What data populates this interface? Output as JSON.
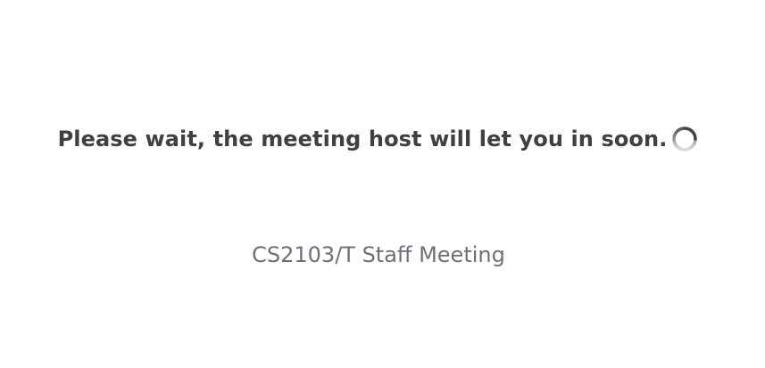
{
  "waiting": {
    "message": "Please wait, the meeting host will let you in soon.",
    "spinner_icon": "loading-spinner-icon"
  },
  "meeting": {
    "title": "CS2103/T Staff Meeting"
  },
  "colors": {
    "message": "#404040",
    "title": "#6e6e7c",
    "spinner": "#555555",
    "background": "#ffffff"
  }
}
